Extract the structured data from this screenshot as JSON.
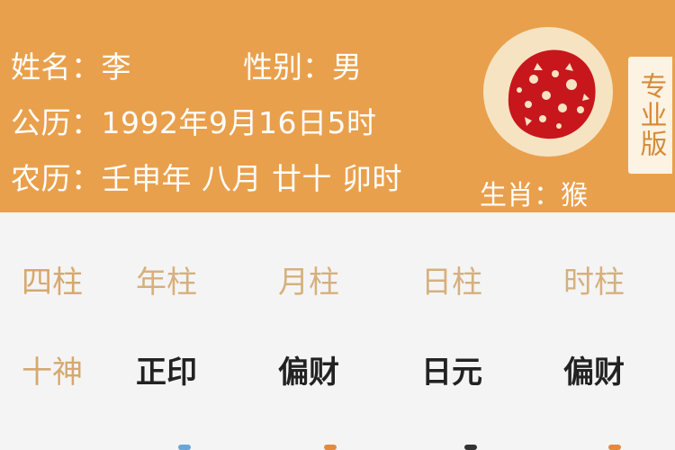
{
  "header": {
    "name_text": "姓名：李",
    "gender_text": "性别：男",
    "solar_text": "公历：1992年9月16日5时",
    "lunar_text": "农历：壬申年 八月 廿十 卯时",
    "zodiac_text": "生肖：猴",
    "pro_tag": "专业版",
    "zodiac_icon": "monkey-papercut-icon"
  },
  "table": {
    "header_row": [
      "四柱",
      "年柱",
      "月柱",
      "日柱",
      "时柱"
    ],
    "tenshen_row": [
      "十神",
      "正印",
      "偏财",
      "日元",
      "偏财"
    ]
  },
  "colors": {
    "header_bg": "#e9a04c",
    "gold_text": "#d6b07c",
    "papercut_red": "#c8161d"
  }
}
